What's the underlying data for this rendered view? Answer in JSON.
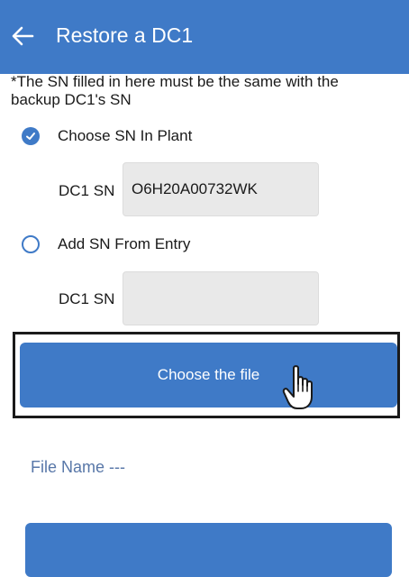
{
  "header": {
    "title": "Restore a DC1",
    "back_icon": "arrow-left-icon",
    "color": "#3f7ac7"
  },
  "note": "*The SN filled in here must be the same with the backup DC1's SN",
  "options": [
    {
      "label": "Choose SN In Plant",
      "selected": true,
      "field_label": "DC1 SN",
      "field_value": "O6H20A00732WK"
    },
    {
      "label": "Add SN From Entry",
      "selected": false,
      "field_label": "DC1 SN",
      "field_value": ""
    }
  ],
  "choose_file_button": "Choose the file",
  "file": {
    "label": "File Name",
    "value": "---"
  }
}
